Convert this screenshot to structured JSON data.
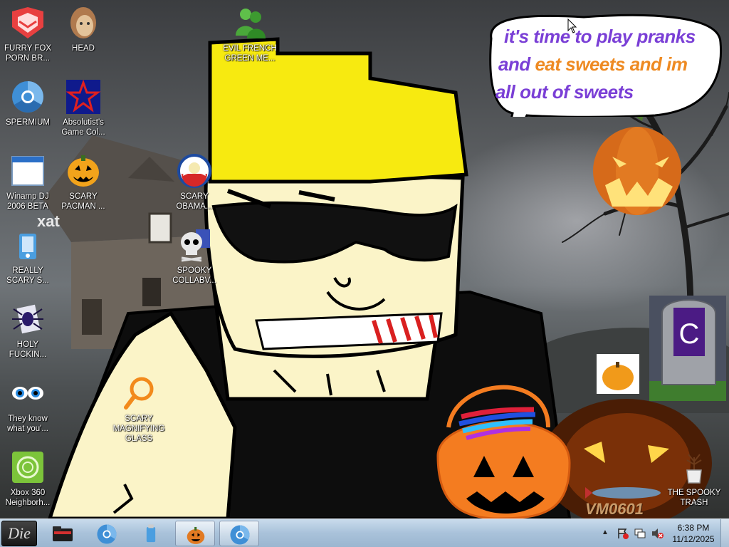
{
  "desktop": {
    "icons": [
      {
        "label": "FURRY FOX PORN BR...",
        "icon": "furry-fox-browser-icon"
      },
      {
        "label": "HEAD",
        "icon": "head-icon"
      },
      {
        "label": "EVIL FRENCH GREEN ME...",
        "icon": "messenger-users-icon"
      },
      {
        "label": "SPERMIUM",
        "icon": "chromium-browser-icon"
      },
      {
        "label": "Absolutist's Game Col...",
        "icon": "absolutist-star-icon"
      },
      {
        "label": "Winamp DJ 2006 BETA",
        "icon": "winamp-window-icon"
      },
      {
        "label": "SCARY PACMAN ...",
        "icon": "jack-o-lantern-pacman-icon"
      },
      {
        "label": "SCARY OBAMA...",
        "icon": "obama-logo-icon"
      },
      {
        "label": "REALLY SCARY S...",
        "icon": "xat-chat-icon"
      },
      {
        "label": "SPOOKY COLLABV...",
        "icon": "skull-icon"
      },
      {
        "label": "HOLY FUCKIN...",
        "icon": "spider-icon"
      },
      {
        "label": "They know what you'...",
        "icon": "eyes-icon"
      },
      {
        "label": "SCARY MAGNIFYING GLASS",
        "icon": "magnifying-glass-icon"
      },
      {
        "label": "Xbox 360 Neighborh...",
        "icon": "xbox-360-icon"
      },
      {
        "label": "THE SPOOKY TRASH",
        "icon": "spooky-trash-icon"
      }
    ],
    "watermark": "xat",
    "logo_text": "VM0601",
    "speech_bubble": {
      "line1": "it's time to play pranks",
      "line2_a": "and ",
      "line2_b": "eat sweets and im",
      "line3": "all out of sweets"
    },
    "colors": {
      "bubble_purple": "#7a3fd6",
      "bubble_orange": "#ee8a22",
      "hat_yellow": "#f7ea10",
      "skin": "#fbf4c8",
      "pumpkin_orange": "#f47c20"
    }
  },
  "taskbar": {
    "start_label": "Die",
    "pinned": [
      {
        "name": "explorer-folder-icon"
      },
      {
        "name": "chromium-icon"
      },
      {
        "name": "usb-drive-icon"
      },
      {
        "name": "pumpkin-icon"
      },
      {
        "name": "chromium-icon"
      }
    ],
    "tray": {
      "icons": [
        "action-center-flag-icon",
        "network-icon",
        "volume-muted-icon"
      ],
      "time": "6:38 PM",
      "date": "11/12/2025"
    }
  }
}
